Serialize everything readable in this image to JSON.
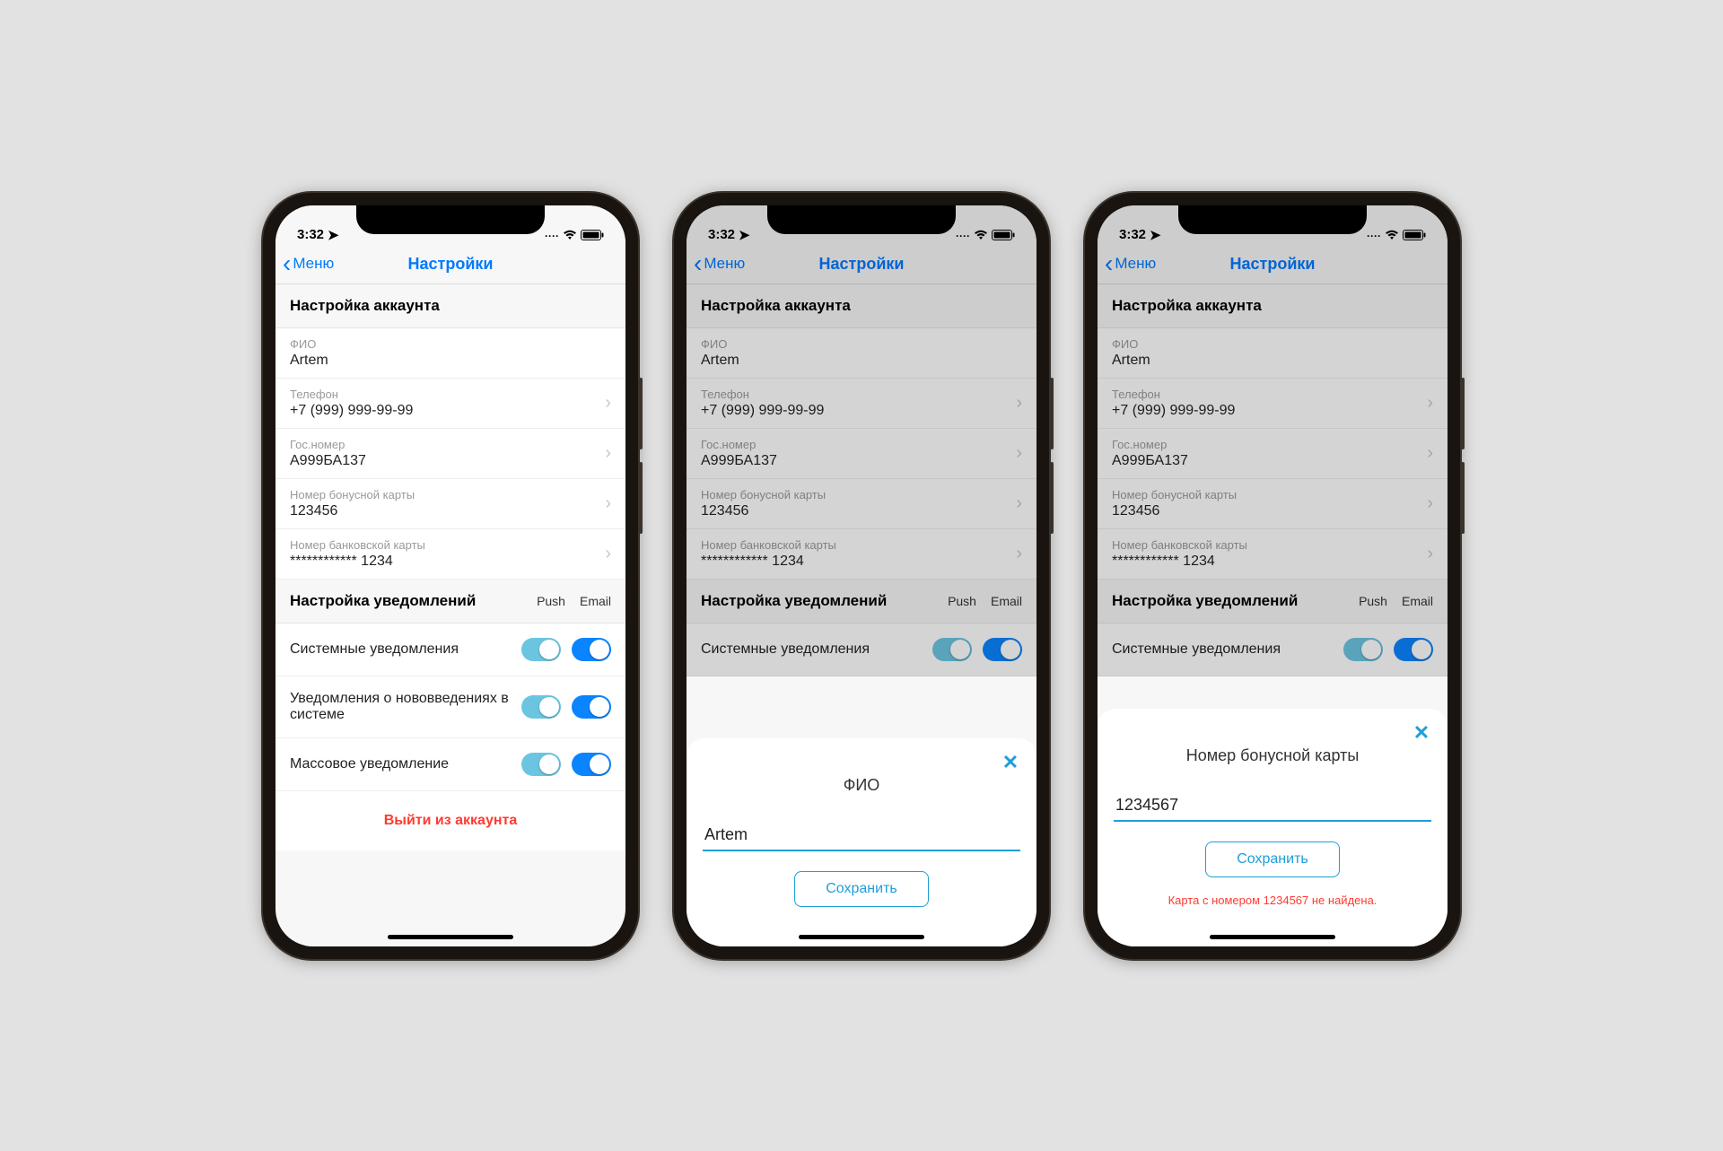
{
  "status": {
    "time": "3:32",
    "location_icon": "➤",
    "dots": "····",
    "wifi": "≋",
    "battery": "▭"
  },
  "nav": {
    "back": "Меню",
    "title": "Настройки"
  },
  "account": {
    "header": "Настройка аккаунта",
    "fields": {
      "fio": {
        "label": "ФИО",
        "value": "Artem"
      },
      "phone": {
        "label": "Телефон",
        "value": "+7 (999) 999-99-99"
      },
      "plate": {
        "label": "Гос.номер",
        "value": "А999БА137"
      },
      "bonus": {
        "label": "Номер бонусной карты",
        "value": "123456"
      },
      "card": {
        "label": "Номер банковской карты",
        "value": "************ 1234"
      }
    }
  },
  "notifications": {
    "header": "Настройка уведомлений",
    "col_push": "Push",
    "col_email": "Email",
    "rows": [
      {
        "label": "Системные уведомления"
      },
      {
        "label": "Уведомления о нововведениях в системе"
      },
      {
        "label": "Массовое уведомление"
      }
    ]
  },
  "logout": "Выйти из аккаунта",
  "sheet_fio": {
    "title": "ФИО",
    "value": "Artem",
    "save": "Сохранить"
  },
  "sheet_bonus": {
    "title": "Номер бонусной карты",
    "value": "1234567",
    "save": "Сохранить",
    "error": "Карта с номером 1234567 не найдена."
  }
}
